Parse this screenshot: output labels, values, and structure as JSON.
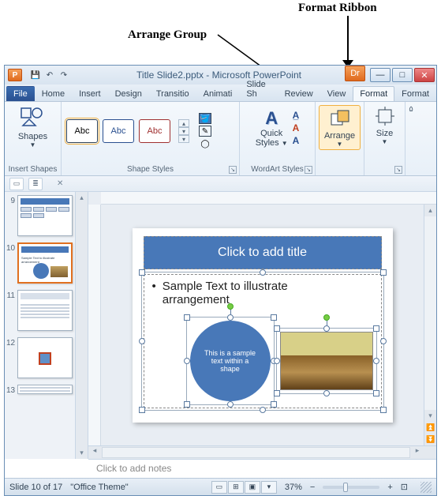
{
  "annotations": {
    "format_ribbon": "Format Ribbon",
    "arrange_group": "Arrange Group"
  },
  "titlebar": {
    "app_icon_letter": "P",
    "title": "Title Slide2.pptx - Microsoft PowerPoint",
    "dr_badge": "Dr"
  },
  "tabs": {
    "file": "File",
    "home": "Home",
    "insert": "Insert",
    "design": "Design",
    "transitions": "Transitio",
    "animations": "Animati",
    "slideshow": "Slide Sh",
    "review": "Review",
    "view": "View",
    "format1": "Format",
    "format2": "Format"
  },
  "ribbon": {
    "shapes": {
      "label": "Shapes",
      "group_label": "Insert Shapes"
    },
    "shape_styles": {
      "sample": "Abc",
      "group_label": "Shape Styles"
    },
    "wordart": {
      "quick_label_line1": "Quick",
      "quick_label_line2": "Styles",
      "group_label": "WordArt Styles"
    },
    "arrange": {
      "label": "Arrange"
    },
    "size": {
      "label": "Size"
    }
  },
  "slide": {
    "title_placeholder": "Click to add title",
    "body_line1": "Sample Text to illustrate",
    "body_line2": "arrangement",
    "circle_line1": "This is a sample",
    "circle_line2": "text within a shape"
  },
  "thumbnails": {
    "n9": "9",
    "n10": "10",
    "n11": "11",
    "n12": "12",
    "n13": "13"
  },
  "notes": {
    "placeholder": "Click to add notes"
  },
  "status": {
    "slide_info": "Slide 10 of 17",
    "theme": "\"Office Theme\"",
    "zoom": "37%"
  }
}
